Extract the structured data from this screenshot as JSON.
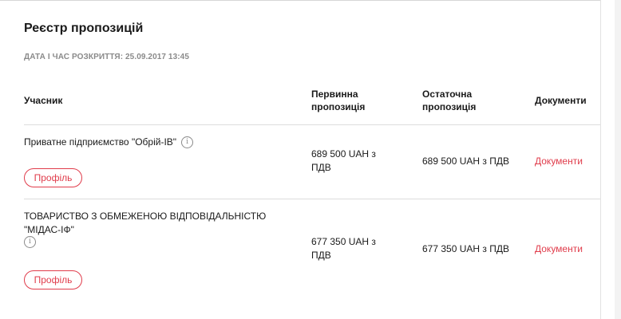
{
  "registry": {
    "title": "Реєстр пропозицій",
    "opened_label": "ДАТА І ЧАС РОЗКРИТТЯ: 25.09.2017 13:45"
  },
  "table": {
    "headers": {
      "participant": "Учасник",
      "initial": "Первинна пропозиція",
      "final": "Остаточна пропозиція",
      "documents": "Документи"
    },
    "rows": [
      {
        "participant": "Приватне підприємство \"Обрій-ІВ\"",
        "profile_label": "Профіль",
        "initial_offer": "689 500 UAH з ПДВ",
        "final_offer": "689 500 UAH з ПДВ",
        "documents_link": "Документи",
        "info_icon": "info-icon"
      },
      {
        "participant": "ТОВАРИСТВО З ОБМЕЖЕНОЮ ВІДПОВІДАЛЬНІСТЮ \"МІДАС-ІФ\"",
        "profile_label": "Профіль",
        "initial_offer": "677 350 UAH з ПДВ",
        "final_offer": "677 350 UAH з ПДВ",
        "documents_link": "Документи",
        "info_icon": "info-icon"
      }
    ]
  },
  "colors": {
    "accent": "#e03c4b",
    "muted": "#8a8a8a",
    "divider": "#dcdcdc"
  }
}
